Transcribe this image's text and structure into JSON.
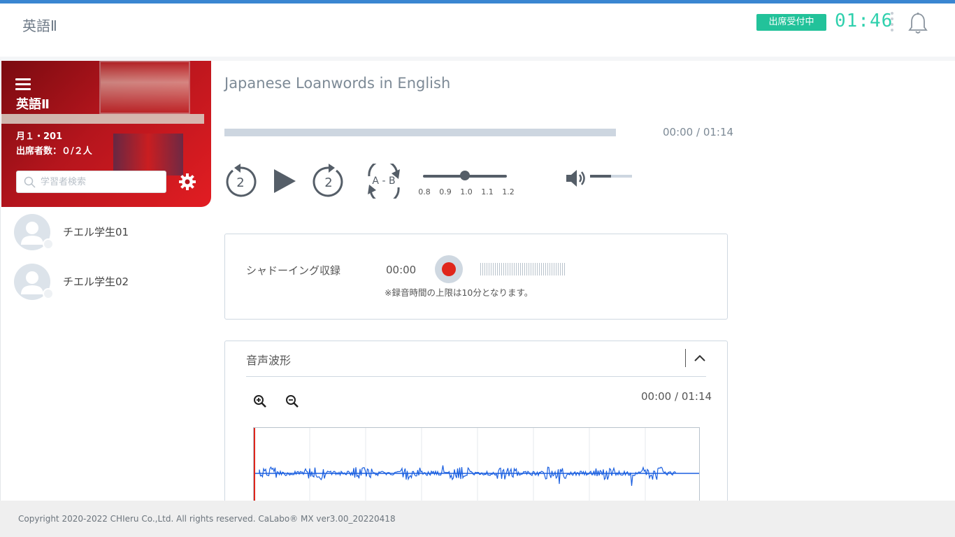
{
  "header": {
    "app_title": "英語Ⅱ",
    "status_badge": "出席受付中",
    "timer": "01:46"
  },
  "sidebar": {
    "class_name": "英語Ⅱ",
    "schedule": "月１・201",
    "attendance": "出席者数：０/２人",
    "search_placeholder": "学習者検索",
    "students": [
      {
        "name": "チエル学生01"
      },
      {
        "name": "チエル学生02"
      }
    ]
  },
  "player": {
    "track_title": "Japanese Loanwords in English",
    "time_display": "00:00 / 01:14",
    "progress": 0,
    "rewind_seconds": "2",
    "forward_seconds": "2",
    "ab_label": "A - B",
    "speed_options": [
      "0.8",
      "0.9",
      "1.0",
      "1.1",
      "1.2"
    ],
    "speed_selected": "1.0",
    "volume": 0.5
  },
  "shadowing": {
    "label": "シャドーイング収録",
    "time": "00:00",
    "note": "※録音時間の上限は10分となります。"
  },
  "waveform": {
    "title": "音声波形",
    "time_display": "00:00 / 01:14"
  },
  "footer": {
    "copyright": "Copyright 2020-2022 CHIeru Co.,Ltd. All rights reserved. CaLabo® MX ver3.00_20220418"
  },
  "colors": {
    "accent": "#3a86d1",
    "status_green": "#22c29a",
    "timer_green": "#2fd0ad",
    "record_red": "#e0261b",
    "waveform_blue": "#1a5fe0",
    "card_red": "#c0171d"
  }
}
